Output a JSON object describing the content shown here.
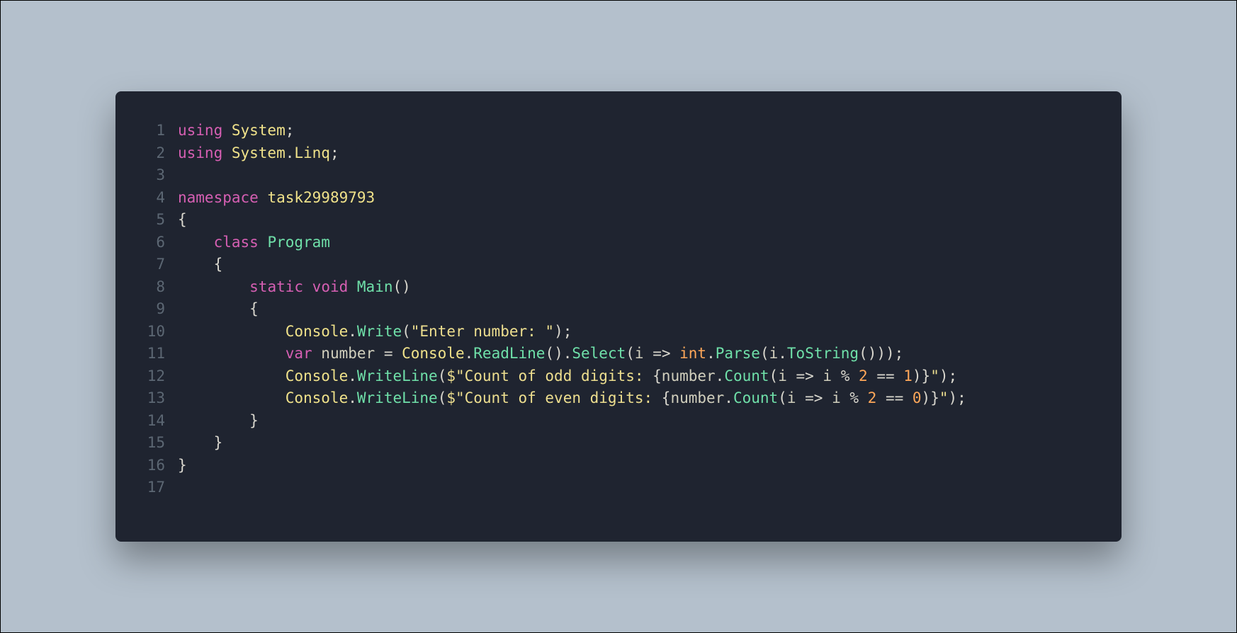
{
  "colors": {
    "background_page": "#b4c0cc",
    "background_editor": "#1f2430",
    "gutter": "#5c6773",
    "keyword": "#d65fb3",
    "namespace": "#f0e28a",
    "type": "#6fe0a9",
    "string": "#eedf8f",
    "number": "#ffa759",
    "default": "#d9d7ce"
  },
  "lines": [
    {
      "n": "1",
      "tokens": [
        {
          "t": "using ",
          "c": "kw"
        },
        {
          "t": "System",
          "c": "ns"
        },
        {
          "t": ";",
          "c": "punc"
        }
      ]
    },
    {
      "n": "2",
      "tokens": [
        {
          "t": "using ",
          "c": "kw"
        },
        {
          "t": "System",
          "c": "ns"
        },
        {
          "t": ".",
          "c": "punc"
        },
        {
          "t": "Linq",
          "c": "ns"
        },
        {
          "t": ";",
          "c": "punc"
        }
      ]
    },
    {
      "n": "3",
      "tokens": []
    },
    {
      "n": "4",
      "tokens": [
        {
          "t": "namespace ",
          "c": "kw"
        },
        {
          "t": "task29989793",
          "c": "ns"
        }
      ]
    },
    {
      "n": "5",
      "tokens": [
        {
          "t": "{",
          "c": "punc"
        }
      ]
    },
    {
      "n": "6",
      "tokens": [
        {
          "t": "    ",
          "c": "punc"
        },
        {
          "t": "class ",
          "c": "kw"
        },
        {
          "t": "Program",
          "c": "type"
        }
      ]
    },
    {
      "n": "7",
      "tokens": [
        {
          "t": "    {",
          "c": "punc"
        }
      ]
    },
    {
      "n": "8",
      "tokens": [
        {
          "t": "        ",
          "c": "punc"
        },
        {
          "t": "static ",
          "c": "kw"
        },
        {
          "t": "void ",
          "c": "kw"
        },
        {
          "t": "Main",
          "c": "type"
        },
        {
          "t": "()",
          "c": "punc"
        }
      ]
    },
    {
      "n": "9",
      "tokens": [
        {
          "t": "        {",
          "c": "punc"
        }
      ]
    },
    {
      "n": "10",
      "tokens": [
        {
          "t": "            ",
          "c": "punc"
        },
        {
          "t": "Console",
          "c": "ns"
        },
        {
          "t": ".",
          "c": "punc"
        },
        {
          "t": "Write",
          "c": "type"
        },
        {
          "t": "(",
          "c": "punc"
        },
        {
          "t": "\"Enter number: \"",
          "c": "str"
        },
        {
          "t": ");",
          "c": "punc"
        }
      ]
    },
    {
      "n": "11",
      "tokens": [
        {
          "t": "            ",
          "c": "punc"
        },
        {
          "t": "var ",
          "c": "kw"
        },
        {
          "t": "number ",
          "c": "var"
        },
        {
          "t": "= ",
          "c": "op"
        },
        {
          "t": "Console",
          "c": "ns"
        },
        {
          "t": ".",
          "c": "punc"
        },
        {
          "t": "ReadLine",
          "c": "type"
        },
        {
          "t": "().",
          "c": "punc"
        },
        {
          "t": "Select",
          "c": "type"
        },
        {
          "t": "(",
          "c": "punc"
        },
        {
          "t": "i ",
          "c": "var"
        },
        {
          "t": "=> ",
          "c": "op"
        },
        {
          "t": "int",
          "c": "num"
        },
        {
          "t": ".",
          "c": "punc"
        },
        {
          "t": "Parse",
          "c": "type"
        },
        {
          "t": "(",
          "c": "punc"
        },
        {
          "t": "i",
          "c": "var"
        },
        {
          "t": ".",
          "c": "punc"
        },
        {
          "t": "ToString",
          "c": "type"
        },
        {
          "t": "()));",
          "c": "punc"
        }
      ]
    },
    {
      "n": "12",
      "tokens": [
        {
          "t": "            ",
          "c": "punc"
        },
        {
          "t": "Console",
          "c": "ns"
        },
        {
          "t": ".",
          "c": "punc"
        },
        {
          "t": "WriteLine",
          "c": "type"
        },
        {
          "t": "(",
          "c": "punc"
        },
        {
          "t": "$\"Count of odd digits: ",
          "c": "str"
        },
        {
          "t": "{",
          "c": "punc"
        },
        {
          "t": "number",
          "c": "var"
        },
        {
          "t": ".",
          "c": "punc"
        },
        {
          "t": "Count",
          "c": "type"
        },
        {
          "t": "(",
          "c": "punc"
        },
        {
          "t": "i ",
          "c": "var"
        },
        {
          "t": "=> ",
          "c": "op"
        },
        {
          "t": "i ",
          "c": "var"
        },
        {
          "t": "% ",
          "c": "op"
        },
        {
          "t": "2",
          "c": "num"
        },
        {
          "t": " == ",
          "c": "op"
        },
        {
          "t": "1",
          "c": "num"
        },
        {
          "t": ")}",
          "c": "punc"
        },
        {
          "t": "\"",
          "c": "str"
        },
        {
          "t": ");",
          "c": "punc"
        }
      ]
    },
    {
      "n": "13",
      "tokens": [
        {
          "t": "            ",
          "c": "punc"
        },
        {
          "t": "Console",
          "c": "ns"
        },
        {
          "t": ".",
          "c": "punc"
        },
        {
          "t": "WriteLine",
          "c": "type"
        },
        {
          "t": "(",
          "c": "punc"
        },
        {
          "t": "$\"Count of even digits: ",
          "c": "str"
        },
        {
          "t": "{",
          "c": "punc"
        },
        {
          "t": "number",
          "c": "var"
        },
        {
          "t": ".",
          "c": "punc"
        },
        {
          "t": "Count",
          "c": "type"
        },
        {
          "t": "(",
          "c": "punc"
        },
        {
          "t": "i ",
          "c": "var"
        },
        {
          "t": "=> ",
          "c": "op"
        },
        {
          "t": "i ",
          "c": "var"
        },
        {
          "t": "% ",
          "c": "op"
        },
        {
          "t": "2",
          "c": "num"
        },
        {
          "t": " == ",
          "c": "op"
        },
        {
          "t": "0",
          "c": "num"
        },
        {
          "t": ")}",
          "c": "punc"
        },
        {
          "t": "\"",
          "c": "str"
        },
        {
          "t": ");",
          "c": "punc"
        }
      ]
    },
    {
      "n": "14",
      "tokens": [
        {
          "t": "        }",
          "c": "punc"
        }
      ]
    },
    {
      "n": "15",
      "tokens": [
        {
          "t": "    }",
          "c": "punc"
        }
      ]
    },
    {
      "n": "16",
      "tokens": [
        {
          "t": "}",
          "c": "punc"
        }
      ]
    },
    {
      "n": "17",
      "tokens": []
    }
  ]
}
